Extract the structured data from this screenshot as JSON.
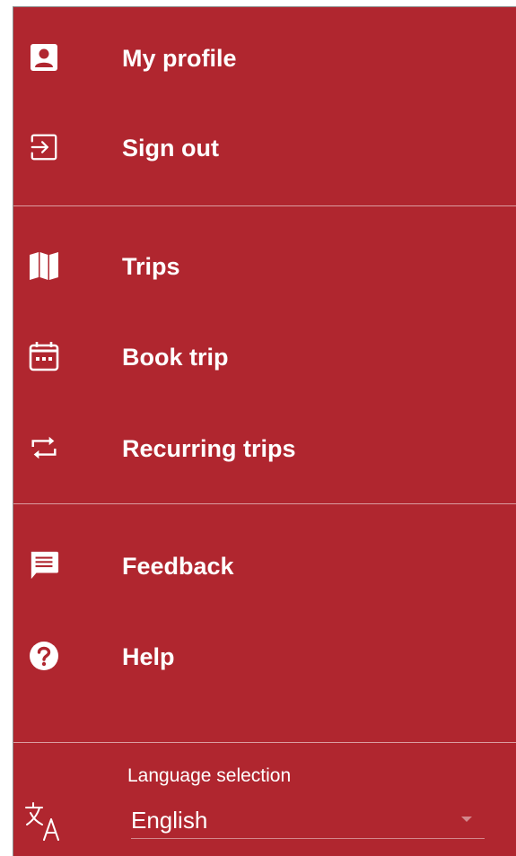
{
  "colors": {
    "drawer_background": "#b0262f",
    "text": "#ffffff",
    "divider": "#d98a8f"
  },
  "menu": {
    "account": [
      {
        "label": "My profile",
        "icon": "person-card-icon"
      },
      {
        "label": "Sign out",
        "icon": "sign-out-icon"
      }
    ],
    "trips": [
      {
        "label": "Trips",
        "icon": "map-icon"
      },
      {
        "label": "Book trip",
        "icon": "calendar-icon"
      },
      {
        "label": "Recurring trips",
        "icon": "repeat-icon"
      }
    ],
    "support": [
      {
        "label": "Feedback",
        "icon": "feedback-icon"
      },
      {
        "label": "Help",
        "icon": "help-icon"
      }
    ]
  },
  "language": {
    "title": "Language selection",
    "selected": "English",
    "icon": "translate-icon"
  }
}
